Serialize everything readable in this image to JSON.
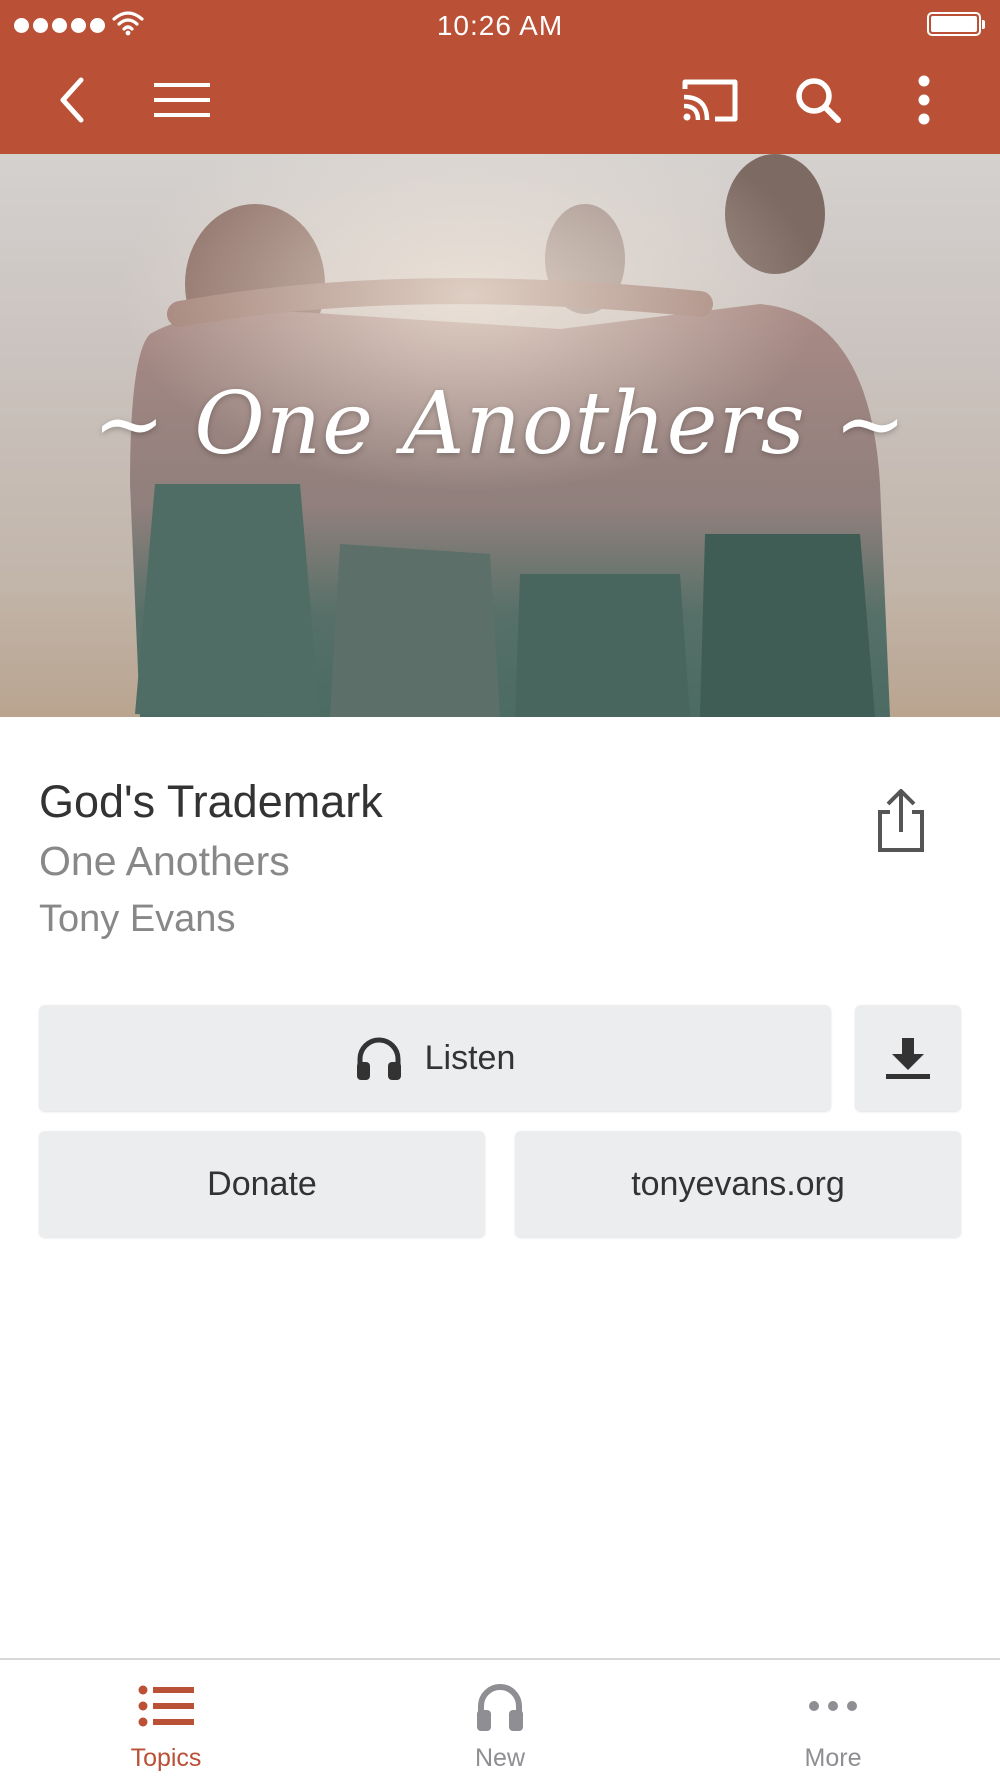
{
  "status_bar": {
    "time": "10:26 AM"
  },
  "nav": {
    "back_icon": "chevron-left-icon",
    "menu_icon": "hamburger-menu-icon",
    "cast_icon": "cast-icon",
    "search_icon": "search-icon",
    "overflow_icon": "more-vertical-icon"
  },
  "hero": {
    "title": "~ One Anothers ~"
  },
  "sermon": {
    "title": "God's Trademark",
    "series": "One Anothers",
    "speaker": "Tony Evans"
  },
  "actions": {
    "listen_label": "Listen",
    "donate_label": "Donate",
    "website_label": "tonyevans.org"
  },
  "tabs": [
    {
      "label": "Topics",
      "icon": "list-icon",
      "active": true
    },
    {
      "label": "New",
      "icon": "headphones-icon",
      "active": false
    },
    {
      "label": "More",
      "icon": "more-horizontal-icon",
      "active": false
    }
  ],
  "colors": {
    "brand": "#ba5035",
    "button_bg": "#ecedef",
    "inactive_tab": "#8e8e93"
  }
}
